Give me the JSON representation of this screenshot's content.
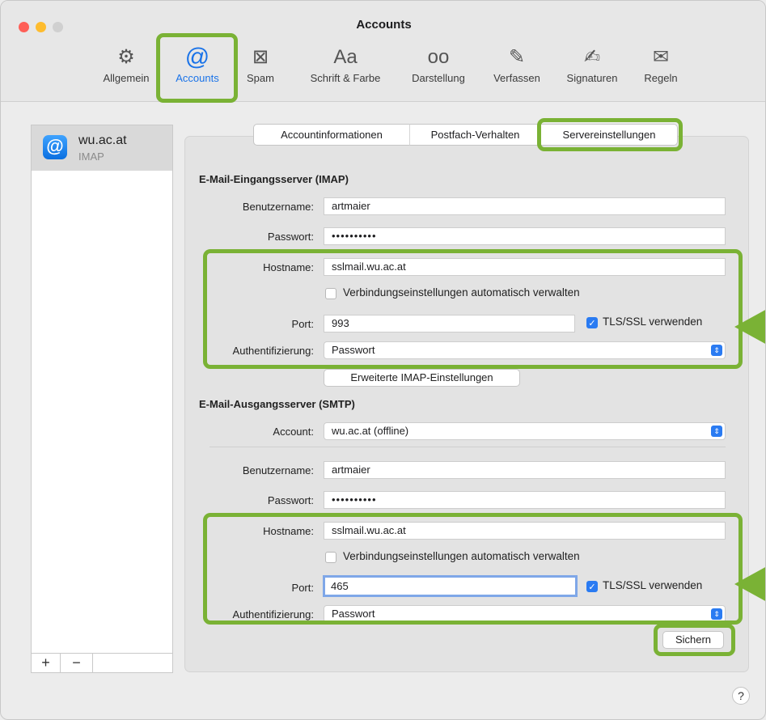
{
  "window": {
    "title": "Accounts"
  },
  "toolbar": {
    "items": [
      {
        "label": "Allgemein",
        "icon": "gear-icon",
        "glyph": "⚙"
      },
      {
        "label": "Accounts",
        "icon": "at-sign-icon",
        "glyph": "@"
      },
      {
        "label": "Spam",
        "icon": "junk-tray-icon",
        "glyph": "⊠"
      },
      {
        "label": "Schrift & Farbe",
        "icon": "font-icon",
        "glyph": "Aa"
      },
      {
        "label": "Darstellung",
        "icon": "glasses-icon",
        "glyph": "oo"
      },
      {
        "label": "Verfassen",
        "icon": "compose-icon",
        "glyph": "✎"
      },
      {
        "label": "Signaturen",
        "icon": "signature-icon",
        "glyph": "✍"
      },
      {
        "label": "Regeln",
        "icon": "rules-envelope-icon",
        "glyph": "✉"
      }
    ]
  },
  "sidebar": {
    "account": {
      "name": "wu.ac.at",
      "type": "IMAP",
      "icon_glyph": "@"
    },
    "add_label": "+",
    "remove_label": "−"
  },
  "tabs": [
    "Accountinformationen",
    "Postfach-Verhalten",
    "Servereinstellungen"
  ],
  "incoming": {
    "heading": "E-Mail-Eingangsserver (IMAP)",
    "username_label": "Benutzername:",
    "username": "artmaier",
    "password_label": "Passwort:",
    "password": "••••••••••",
    "hostname_label": "Hostname:",
    "hostname": "sslmail.wu.ac.at",
    "auto_manage_label": "Verbindungseinstellungen automatisch verwalten",
    "auto_manage_checked": false,
    "port_label": "Port:",
    "port": "993",
    "tls_label": "TLS/SSL verwenden",
    "tls_checked": true,
    "auth_label": "Authentifizierung:",
    "auth": "Passwort",
    "advanced_button": "Erweiterte IMAP-Einstellungen"
  },
  "outgoing": {
    "heading": "E-Mail-Ausgangsserver (SMTP)",
    "account_label": "Account:",
    "account": "wu.ac.at (offline)",
    "username_label": "Benutzername:",
    "username": "artmaier",
    "password_label": "Passwort:",
    "password": "••••••••••",
    "hostname_label": "Hostname:",
    "hostname": "sslmail.wu.ac.at",
    "auto_manage_label": "Verbindungseinstellungen automatisch verwalten",
    "auto_manage_checked": false,
    "port_label": "Port:",
    "port": "465",
    "tls_label": "TLS/SSL verwenden",
    "tls_checked": true,
    "auth_label": "Authentifizierung:",
    "auth": "Passwort"
  },
  "save_button": "Sichern",
  "help_label": "?",
  "colors": {
    "highlight": "#7ab235",
    "accent": "#2a7bf2",
    "close": "#fe5f57",
    "minimize": "#febc2e",
    "zoom": "#d0d0d0"
  }
}
